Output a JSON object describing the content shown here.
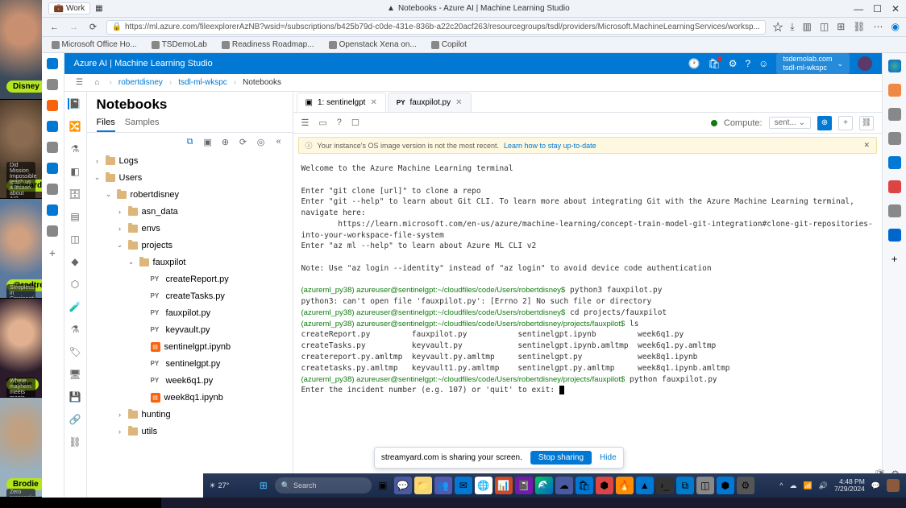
{
  "participants": [
    {
      "name": "Disney",
      "subtitle": ""
    },
    {
      "name": "Edward",
      "subtitle": "Did Mission Impossible teach us a lesson about AI?"
    },
    {
      "name": "@rodtrent",
      "subtitle": "Sleepless in Cincinnati"
    },
    {
      "name": "Raae",
      "subtitle": "Where mayhem meets magic"
    },
    {
      "name": "Brodie",
      "subtitle": "Zero preparation"
    }
  ],
  "window": {
    "workLabel": "Work",
    "title": "Notebooks - Azure AI | Machine Learning Studio",
    "url": "https://ml.azure.com/fileexplorerAzNB?wsid=/subscriptions/b425b79d-c0de-431e-836b-a22c20acf263/resourcegroups/tsdl/providers/Microsoft.MachineLearningServices/worksp..."
  },
  "bookmarks": [
    "Microsoft Office Ho...",
    "TSDemoLab",
    "Readiness Roadmap...",
    "Openstack Xena on...",
    "Copilot"
  ],
  "blueHeader": {
    "title": "Azure AI | Machine Learning Studio",
    "workspace_top": "tsdemolab.com",
    "workspace_bottom": "tsdl-ml-wkspc"
  },
  "breadcrumb": [
    "robertdisney",
    "tsdl-ml-wkspc",
    "Notebooks"
  ],
  "filePanel": {
    "title": "Notebooks",
    "tabs": [
      "Files",
      "Samples"
    ],
    "tree": [
      {
        "depth": 0,
        "type": "folder",
        "name": "Logs",
        "expand": "›"
      },
      {
        "depth": 0,
        "type": "folder",
        "name": "Users",
        "expand": "⌄"
      },
      {
        "depth": 1,
        "type": "folder",
        "name": "robertdisney",
        "expand": "⌄"
      },
      {
        "depth": 2,
        "type": "folder",
        "name": "asn_data",
        "expand": "›"
      },
      {
        "depth": 2,
        "type": "folder",
        "name": "envs",
        "expand": "›"
      },
      {
        "depth": 2,
        "type": "folder",
        "name": "projects",
        "expand": "⌄"
      },
      {
        "depth": 3,
        "type": "folder",
        "name": "fauxpilot",
        "expand": "⌄"
      },
      {
        "depth": 4,
        "type": "py",
        "name": "createReport.py"
      },
      {
        "depth": 4,
        "type": "py",
        "name": "createTasks.py"
      },
      {
        "depth": 4,
        "type": "py",
        "name": "fauxpilot.py"
      },
      {
        "depth": 4,
        "type": "py",
        "name": "keyvault.py"
      },
      {
        "depth": 4,
        "type": "nb",
        "name": "sentinelgpt.ipynb"
      },
      {
        "depth": 4,
        "type": "py",
        "name": "sentinelgpt.py"
      },
      {
        "depth": 4,
        "type": "py",
        "name": "week6q1.py"
      },
      {
        "depth": 4,
        "type": "nb",
        "name": "week8q1.ipynb"
      },
      {
        "depth": 2,
        "type": "folder",
        "name": "hunting",
        "expand": "›"
      },
      {
        "depth": 2,
        "type": "folder",
        "name": "utils",
        "expand": "›"
      }
    ]
  },
  "editor": {
    "tabs": [
      {
        "icon": "▣",
        "label": "1: sentinelgpt",
        "active": true
      },
      {
        "icon": "PY",
        "label": "fauxpilot.py",
        "active": false
      }
    ],
    "computeLabel": "Compute:",
    "computeValue": "sent...",
    "warning": "Your instance's OS image version is not the most recent.",
    "warningLink": "Learn how to stay up-to-date",
    "terminal": {
      "welcome": "Welcome to the Azure Machine Learning terminal",
      "hints": "Enter \"git clone [url]\" to clone a repo\nEnter \"git --help\" to learn about Git CLI. To learn more about integrating Git with the Azure Machine Learning terminal, navigate here:\n        https://learn.microsoft.com/en-us/azure/machine-learning/concept-train-model-git-integration#clone-git-repositories-into-your-workspace-file-system\nEnter \"az ml --help\" to learn about Azure ML CLI v2\n\nNote: Use \"az login --identity\" instead of \"az login\" to avoid device code authentication",
      "lines": [
        {
          "prompt": "(azureml_py38) azureuser@sentinelgpt:~/cloudfiles/code/Users/robertdisney$",
          "cmd": " python3 fauxpilot.py"
        },
        {
          "plain": "python3: can't open file 'fauxpilot.py': [Errno 2] No such file or directory"
        },
        {
          "prompt": "(azureml_py38) azureuser@sentinelgpt:~/cloudfiles/code/Users/robertdisney$",
          "cmd": " cd projects/fauxpilot"
        },
        {
          "prompt": "(azureml_py38) azureuser@sentinelgpt:~/cloudfiles/code/Users/robertdisney/projects/fauxpilot$",
          "cmd": " ls"
        },
        {
          "plain": "createReport.py         fauxpilot.py           sentinelgpt.ipynb         week6q1.py"
        },
        {
          "plain": "createTasks.py          keyvault.py            sentinelgpt.ipynb.amltmp  week6q1.py.amltmp"
        },
        {
          "plain": "createreport.py.amltmp  keyvault.py.amltmp     sentinelgpt.py            week8q1.ipynb"
        },
        {
          "plain": "createtasks.py.amltmp   keyvault1.py.amltmp    sentinelgpt.py.amltmp     week8q1.ipynb.amltmp"
        },
        {
          "prompt": "(azureml_py38) azureuser@sentinelgpt:~/cloudfiles/code/Users/robertdisney/projects/fauxpilot$",
          "cmd": " python fauxpilot.py"
        },
        {
          "plain": "Enter the incident number (e.g. 107) or 'quit' to exit: "
        }
      ]
    }
  },
  "shareToast": {
    "text": "streamyard.com is sharing your screen.",
    "stop": "Stop sharing",
    "hide": "Hide"
  },
  "taskbar": {
    "weather": "27°",
    "searchPlaceholder": "Search",
    "time": "4:48 PM",
    "date": "7/29/2024"
  }
}
